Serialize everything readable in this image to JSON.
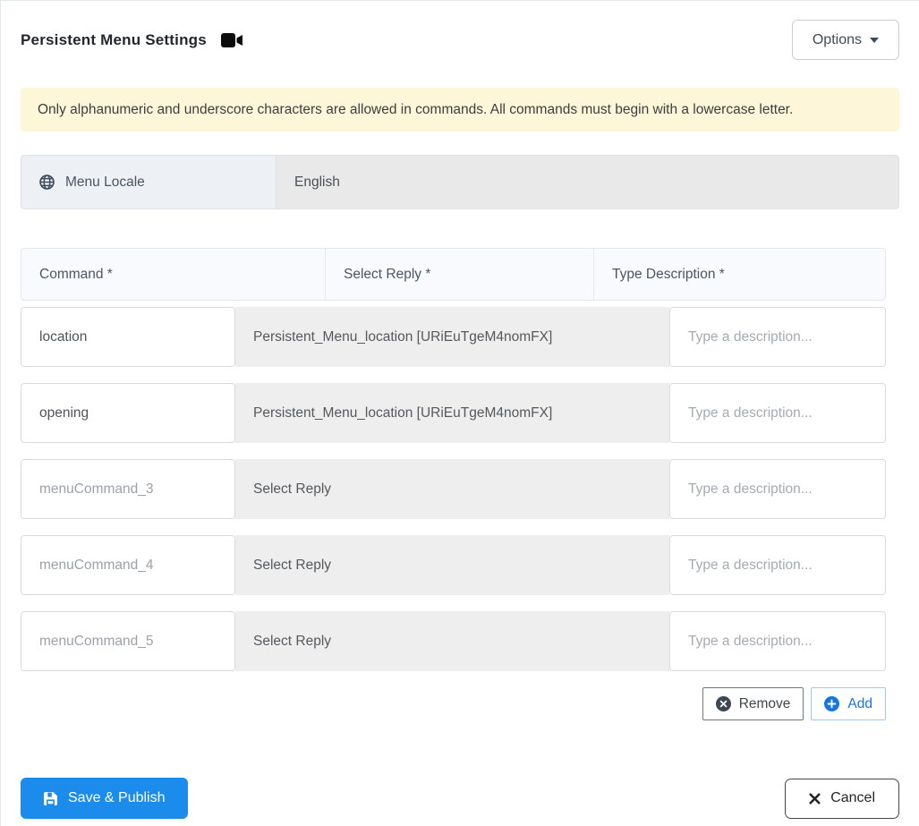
{
  "header": {
    "title": "Persistent Menu Settings",
    "options_label": "Options"
  },
  "alert": {
    "text": "Only alphanumeric and underscore characters are allowed in commands. All commands must begin with a lowercase letter."
  },
  "locale": {
    "label": "Menu Locale",
    "value": "English"
  },
  "table": {
    "headers": [
      "Command *",
      "Select Reply *",
      "Type Description *"
    ],
    "rows": [
      {
        "command": "location",
        "command_is_default": false,
        "reply": "Persistent_Menu_location [URiEuTgeM4nomFX]",
        "description_value": "",
        "description_placeholder": "Type a description..."
      },
      {
        "command": "opening",
        "command_is_default": false,
        "reply": "Persistent_Menu_location [URiEuTgeM4nomFX]",
        "description_value": "",
        "description_placeholder": "Type a description..."
      },
      {
        "command": "menuCommand_3",
        "command_is_default": true,
        "reply": "Select Reply",
        "description_value": "",
        "description_placeholder": "Type a description..."
      },
      {
        "command": "menuCommand_4",
        "command_is_default": true,
        "reply": "Select Reply",
        "description_value": "",
        "description_placeholder": "Type a description..."
      },
      {
        "command": "menuCommand_5",
        "command_is_default": true,
        "reply": "Select Reply",
        "description_value": "",
        "description_placeholder": "Type a description..."
      }
    ]
  },
  "actions": {
    "remove_label": "Remove",
    "add_label": "Add"
  },
  "footer": {
    "save_label": "Save & Publish",
    "cancel_label": "Cancel"
  },
  "colors": {
    "primary_blue": "#1b8ceb",
    "add_blue": "#1a73e8",
    "alert_background": "#fdf6d8",
    "disabled_gray": "#e9e9e9",
    "reply_gray": "#eeeeee",
    "header_gray": "#f8fafd"
  }
}
